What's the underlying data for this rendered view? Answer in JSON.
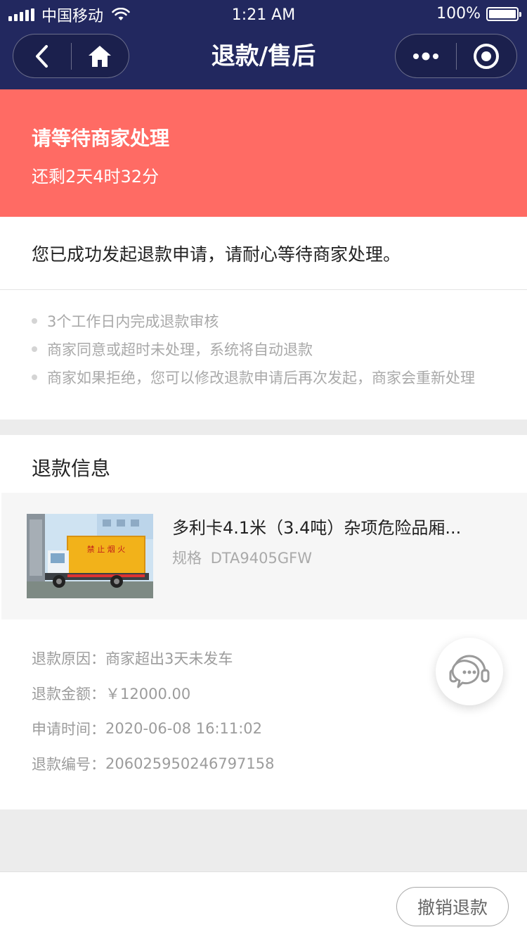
{
  "status_bar": {
    "carrier": "中国移动",
    "time": "1:21 AM",
    "battery": "100%"
  },
  "nav": {
    "title": "退款/售后",
    "icons": [
      "back-icon",
      "home-icon",
      "more-icon",
      "close-capsule-icon"
    ]
  },
  "banner": {
    "title": "请等待商家处理",
    "countdown": "还剩2天4时32分",
    "color": "#ff6b64"
  },
  "notice": "您已成功发起退款申请，请耐心等待商家处理。",
  "tips": [
    "3个工作日内完成退款审核",
    "商家同意或超时未处理，系统将自动退款",
    "商家如果拒绝，您可以修改退款申请后再次发起，商家会重新处理"
  ],
  "refund_info": {
    "section_title": "退款信息",
    "product": {
      "name": "多利卡4.1米（3.4吨）杂项危险品厢...",
      "spec_label": "规格",
      "spec_value": "DTA9405GFW",
      "image_sign": "禁 止 烟 火"
    },
    "rows": [
      {
        "label": "退款原因：",
        "value": "商家超出3天未发车"
      },
      {
        "label": "退款金额：",
        "value": "￥12000.00"
      },
      {
        "label": "申请时间：",
        "value": "2020-06-08 16:11:02"
      },
      {
        "label": "退款编号：",
        "value": "206025950246797158"
      }
    ]
  },
  "footer": {
    "cancel_label": "撤销退款"
  },
  "colors": {
    "header_bg": "#22285f",
    "accent": "#ff6b64"
  }
}
